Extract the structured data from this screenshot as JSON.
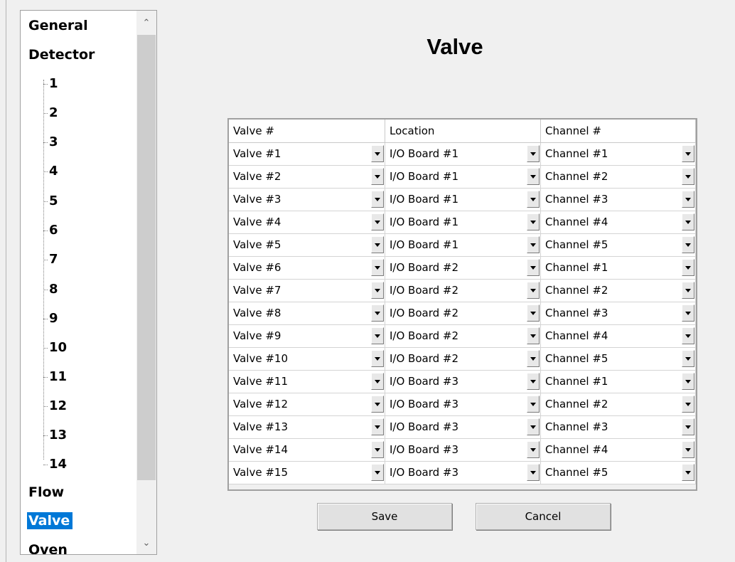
{
  "page": {
    "title": "Valve"
  },
  "tree": {
    "nodes": [
      {
        "label": "General"
      },
      {
        "label": "Detector"
      },
      {
        "label": "Flow"
      },
      {
        "label": "Valve",
        "selected": true
      },
      {
        "label": "Oven"
      }
    ],
    "detector_children": [
      "1",
      "2",
      "3",
      "4",
      "5",
      "6",
      "7",
      "8",
      "9",
      "10",
      "11",
      "12",
      "13",
      "14"
    ],
    "scroll_up_icon": "chevron-up-icon",
    "scroll_down_icon": "chevron-down-icon"
  },
  "grid": {
    "headers": [
      "Valve #",
      "Location",
      "Channel #"
    ],
    "rows": [
      [
        "Valve #1",
        "I/O Board #1",
        "Channel #1"
      ],
      [
        "Valve #2",
        "I/O Board #1",
        "Channel #2"
      ],
      [
        "Valve #3",
        "I/O Board #1",
        "Channel #3"
      ],
      [
        "Valve #4",
        "I/O Board #1",
        "Channel #4"
      ],
      [
        "Valve #5",
        "I/O Board #1",
        "Channel #5"
      ],
      [
        "Valve #6",
        "I/O Board #2",
        "Channel #1"
      ],
      [
        "Valve #7",
        "I/O Board #2",
        "Channel #2"
      ],
      [
        "Valve #8",
        "I/O Board #2",
        "Channel #3"
      ],
      [
        "Valve #9",
        "I/O Board #2",
        "Channel #4"
      ],
      [
        "Valve #10",
        "I/O Board #2",
        "Channel #5"
      ],
      [
        "Valve #11",
        "I/O Board #3",
        "Channel #1"
      ],
      [
        "Valve #12",
        "I/O Board #3",
        "Channel #2"
      ],
      [
        "Valve #13",
        "I/O Board #3",
        "Channel #3"
      ],
      [
        "Valve #14",
        "I/O Board #3",
        "Channel #4"
      ],
      [
        "Valve #15",
        "I/O Board #3",
        "Channel #5"
      ]
    ]
  },
  "buttons": {
    "save": "Save",
    "cancel": "Cancel"
  },
  "colors": {
    "selection": "#0078d7"
  }
}
